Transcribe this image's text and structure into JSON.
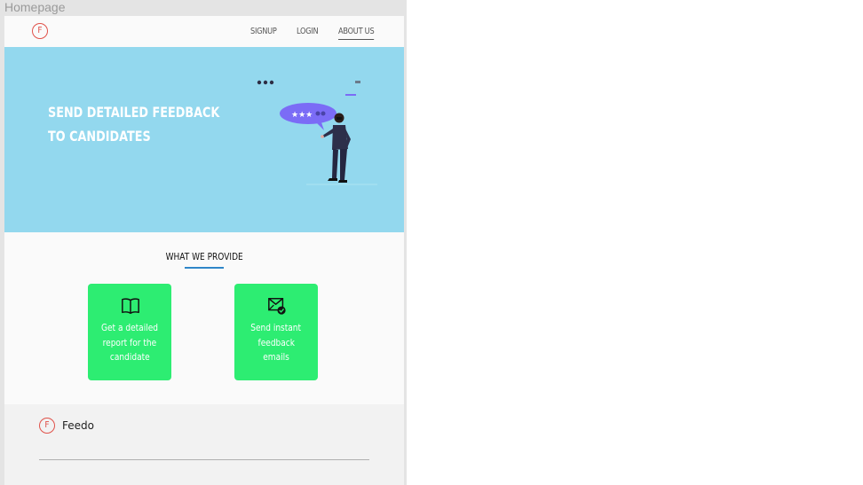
{
  "frame": {
    "label": "Homepage"
  },
  "navbar": {
    "logo_letter": "F",
    "links": [
      {
        "label": "SIGNUP"
      },
      {
        "label": "LOGIN"
      },
      {
        "label": "ABOUT US"
      }
    ]
  },
  "hero": {
    "title_line1": "SEND DETAILED FEEDBACK",
    "title_line2": "TO CANDIDATES",
    "illustration": "person-feedback-bubble-illustration"
  },
  "provide": {
    "heading": "WHAT WE PROVIDE",
    "cards": [
      {
        "icon": "book-icon",
        "lines": [
          "Get a detailed",
          "report for the",
          "candidate"
        ]
      },
      {
        "icon": "mail-check-icon",
        "lines": [
          "Send instant",
          "feedback",
          "emails"
        ]
      }
    ]
  },
  "footer": {
    "logo_letter": "F",
    "brand": "Feedo"
  },
  "colors": {
    "hero_bg": "#93d8ee",
    "card_bg": "#2ded72",
    "logo_red": "#e0524a",
    "accent_blue": "#2f86c8",
    "bubble_purple": "#7b6cf6"
  }
}
